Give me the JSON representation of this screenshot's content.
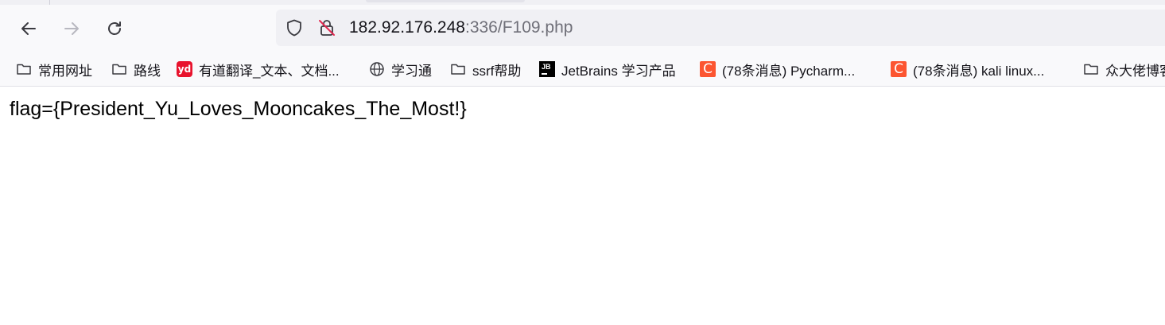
{
  "address_bar": {
    "host": "182.92.176.248",
    "rest": ":336/F109.php"
  },
  "bookmarks": [
    {
      "label": "常用网址",
      "icon": "folder-icon"
    },
    {
      "label": "路线",
      "icon": "folder-icon"
    },
    {
      "label": "有道翻译_文本、文档...",
      "icon": "youdao-icon",
      "icon_text": "yd"
    },
    {
      "label": "学习通",
      "icon": "globe-icon"
    },
    {
      "label": "ssrf帮助",
      "icon": "folder-icon"
    },
    {
      "label": "JetBrains 学习产品",
      "icon": "jetbrains-icon",
      "icon_text": "JB"
    },
    {
      "label": "(78条消息) Pycharm...",
      "icon": "csdn-icon",
      "icon_text": "C"
    },
    {
      "label": "(78条消息) kali linux...",
      "icon": "csdn-icon",
      "icon_text": "C"
    },
    {
      "label": "众大佬博客",
      "icon": "folder-icon"
    }
  ],
  "page": {
    "text": "flag={President_Yu_Loves_Mooncakes_The_Most!}"
  },
  "colors": {
    "youdao": "#e8132d",
    "csdn": "#fc5531",
    "jetbrains": "#000000",
    "insecure_lock": "#e22850"
  }
}
